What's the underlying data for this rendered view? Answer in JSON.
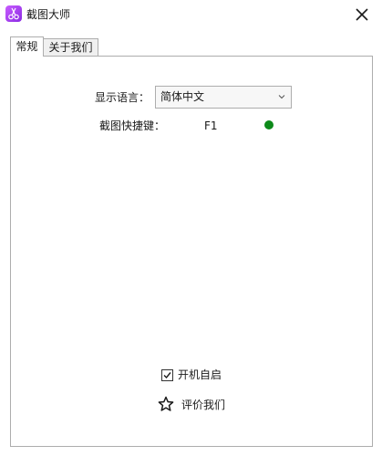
{
  "window": {
    "title": "截图大师",
    "icon": "scissors-icon",
    "close_icon": "close-icon"
  },
  "tabs": [
    {
      "label": "常规",
      "active": true
    },
    {
      "label": "关于我们",
      "active": false
    }
  ],
  "settings": {
    "language_label": "显示语言：",
    "language_value": "简体中文",
    "hotkey_label": "截图快捷键：",
    "hotkey_value": "F1",
    "hotkey_status_color": "#0d8a1a",
    "autostart_label": "开机自启",
    "autostart_checked": true,
    "rate_label": "评价我们",
    "rate_icon": "star-icon"
  },
  "colors": {
    "accent": "#a040f0",
    "status_ok": "#0d8a1a",
    "border": "#adadad"
  }
}
